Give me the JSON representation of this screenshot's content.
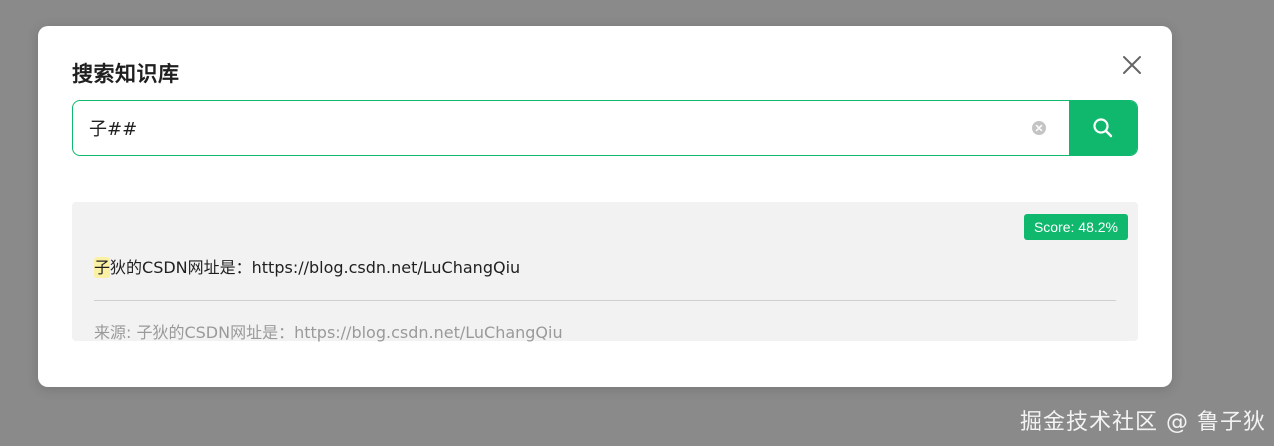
{
  "dialog": {
    "title": "搜索知识库"
  },
  "search": {
    "value": "子##",
    "placeholder": ""
  },
  "result": {
    "highlight": "子",
    "text_rest": "狄的CSDN网址是：https://blog.csdn.net/LuChangQiu",
    "score": "Score: 48.2%",
    "source": "来源: 子狄的CSDN网址是：https://blog.csdn.net/LuChangQiu"
  },
  "watermark": "掘金技术社区 @ 鲁子狄",
  "colors": {
    "accent": "#0fb86d",
    "highlight": "#fbf1a5",
    "overlay": "#8a8a8a"
  },
  "icons": {
    "close": "close-icon",
    "clear": "clear-icon",
    "search": "search-icon"
  }
}
